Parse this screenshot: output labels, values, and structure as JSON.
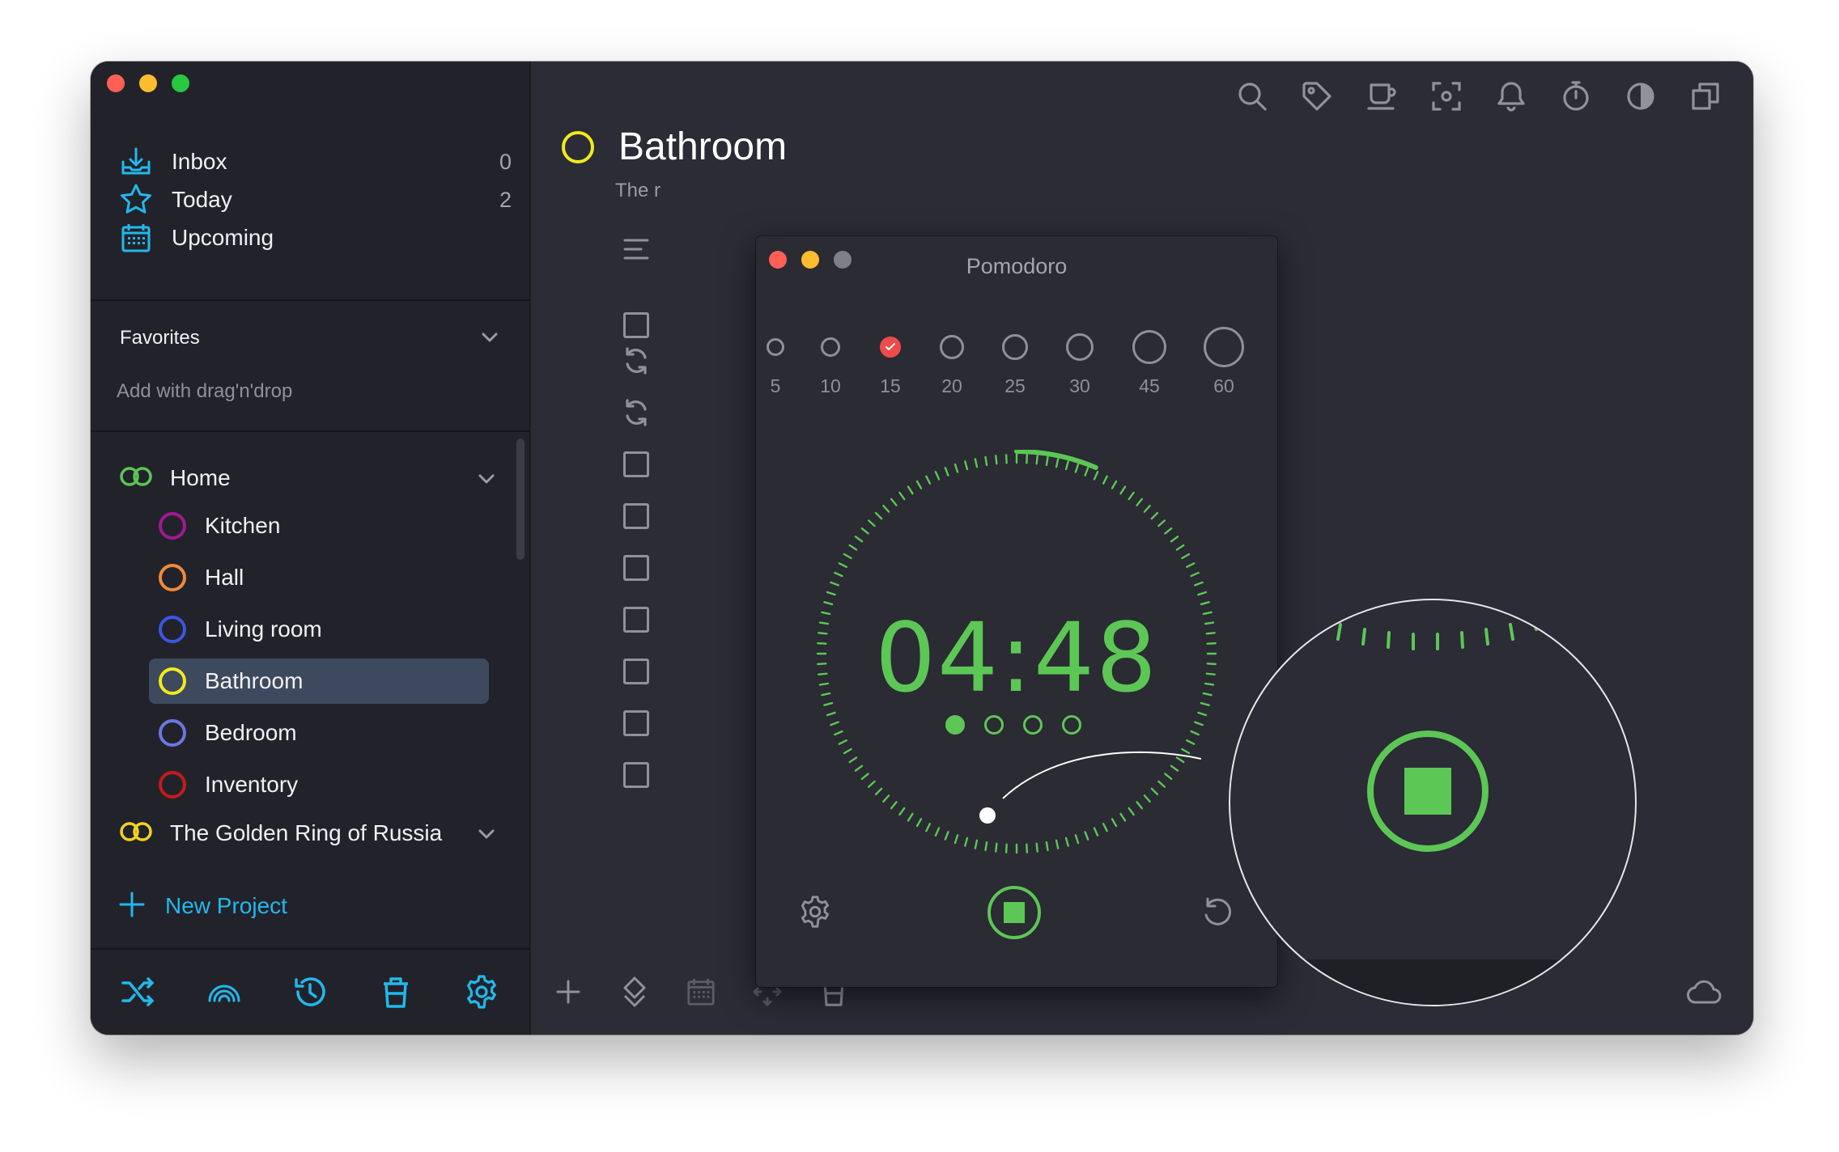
{
  "sidebar": {
    "nav": [
      {
        "label": "Inbox",
        "count": "0",
        "icon": "inbox-icon"
      },
      {
        "label": "Today",
        "count": "2",
        "icon": "star-icon"
      },
      {
        "label": "Upcoming",
        "count": "",
        "icon": "calendar-icon"
      }
    ],
    "favorites": {
      "title": "Favorites",
      "hint": "Add with drag'n'drop"
    },
    "projects": [
      {
        "label": "Home",
        "color": "#5cc755"
      },
      {
        "label": "The Golden Ring of Russia",
        "color": "#f3d322"
      }
    ],
    "areas": [
      {
        "label": "Kitchen",
        "color": "#a31893"
      },
      {
        "label": "Hall",
        "color": "#f08a3c"
      },
      {
        "label": "Living room",
        "color": "#3b56e4"
      },
      {
        "label": "Bathroom",
        "color": "#f3ea1c"
      },
      {
        "label": "Bedroom",
        "color": "#6a77e2"
      },
      {
        "label": "Inventory",
        "color": "#c71a1a"
      }
    ],
    "new_project": "New Project",
    "accent": "#22b8ee"
  },
  "main": {
    "title": "Bathroom",
    "notes": "The r",
    "title_color": "#f3ea1c"
  },
  "pomodoro": {
    "title": "Pomodoro",
    "durations": [
      "5",
      "10",
      "15",
      "20",
      "25",
      "30",
      "45",
      "60"
    ],
    "selected_duration": "15",
    "time": "04:48",
    "sessions_total": 4,
    "sessions_done": 1,
    "progress": 0.04,
    "accent": "#5cc755"
  }
}
